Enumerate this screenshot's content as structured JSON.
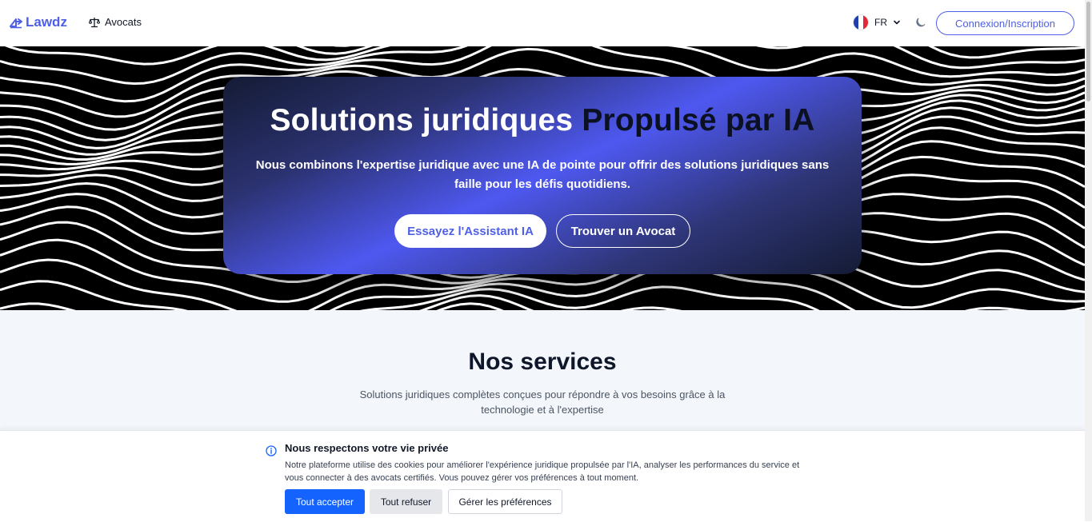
{
  "navbar": {
    "logo_text": "Lawdz",
    "lawyers_link": "Avocats",
    "language_code": "FR",
    "login_button": "Connexion/Inscription"
  },
  "hero": {
    "title_main": "Solutions juridiques",
    "title_accent": "Propulsé par IA",
    "subtitle": "Nous combinons l'expertise juridique avec une IA de pointe pour offrir des solutions juridiques sans faille pour les défis quotidiens.",
    "primary_button": "Essayez l'Assistant IA",
    "secondary_button": "Trouver un Avocat"
  },
  "services": {
    "title": "Nos services",
    "subtitle": "Solutions juridiques complètes conçues pour répondre à vos besoins grâce à la technologie et à l'expertise"
  },
  "cookie_banner": {
    "title": "Nous respectons votre vie privée",
    "text": "Notre plateforme utilise des cookies pour améliorer l'expérience juridique propulsée par l'IA, analyser les performances du service et vous connecter à des avocats certifiés. Vous pouvez gérer vos préférences à tout moment.",
    "accept_button": "Tout accepter",
    "reject_button": "Tout refuser",
    "preferences_button": "Gérer les préférences"
  },
  "colors": {
    "brand": "#4f5fe6",
    "primary_blue": "#1463ff",
    "services_bg": "#f3f6fa"
  },
  "icons": {
    "logo": "scale-logo-icon",
    "lawyers": "scales-icon",
    "language": "france-flag-icon",
    "dropdown": "chevron-down-icon",
    "theme": "moon-icon",
    "cookie": "info-icon"
  }
}
